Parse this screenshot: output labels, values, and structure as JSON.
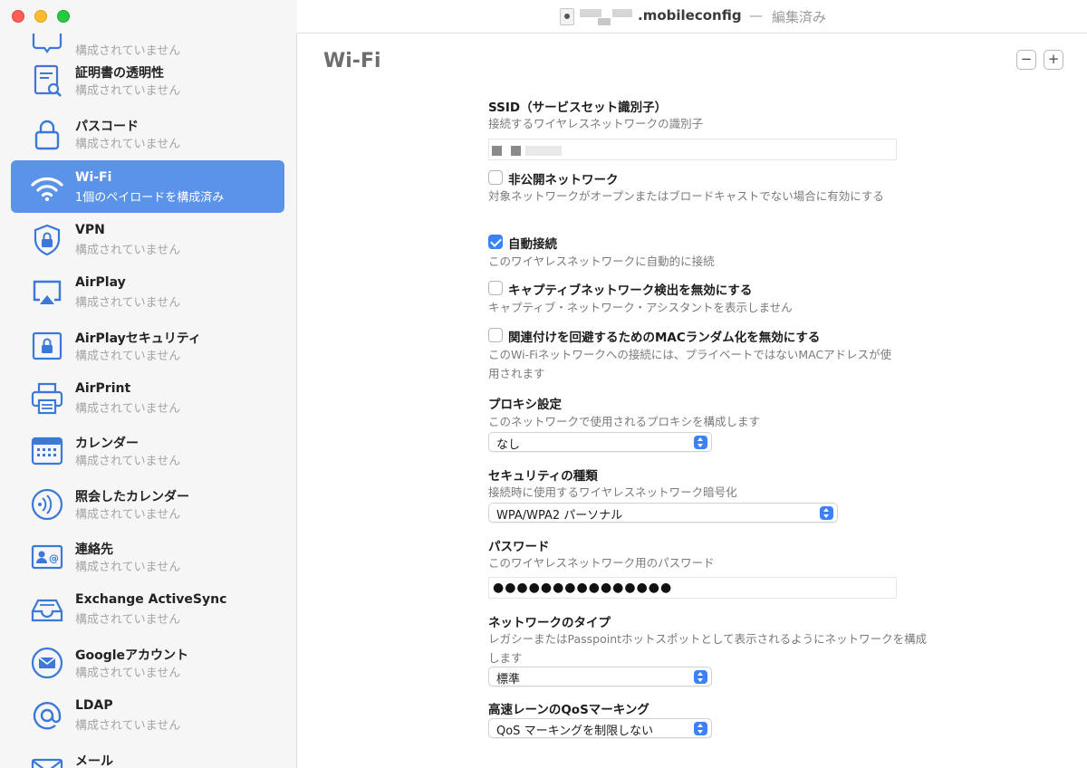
{
  "window": {
    "filename": ".mobileconfig",
    "separator": "—",
    "status": "編集済み"
  },
  "sidebar": {
    "items": [
      {
        "title": "",
        "subtitle": "構成されていません",
        "icon": "speech-bubble-icon"
      },
      {
        "title": "証明書の透明性",
        "subtitle": "構成されていません",
        "icon": "certificate-search-icon"
      },
      {
        "title": "パスコード",
        "subtitle": "構成されていません",
        "icon": "lock-icon"
      },
      {
        "title": "Wi-Fi",
        "subtitle": "1個のペイロードを構成済み",
        "icon": "wifi-icon",
        "selected": true
      },
      {
        "title": "VPN",
        "subtitle": "構成されていません",
        "icon": "shield-lock-icon"
      },
      {
        "title": "AirPlay",
        "subtitle": "構成されていません",
        "icon": "airplay-icon"
      },
      {
        "title": "AirPlayセキュリティ",
        "subtitle": "構成されていません",
        "icon": "airplay-lock-icon"
      },
      {
        "title": "AirPrint",
        "subtitle": "構成されていません",
        "icon": "printer-icon"
      },
      {
        "title": "カレンダー",
        "subtitle": "構成されていません",
        "icon": "calendar-icon"
      },
      {
        "title": "照会したカレンダー",
        "subtitle": "構成されていません",
        "icon": "subscribed-calendar-icon"
      },
      {
        "title": "連絡先",
        "subtitle": "構成されていません",
        "icon": "contacts-icon"
      },
      {
        "title": "Exchange ActiveSync",
        "subtitle": "構成されていません",
        "icon": "inbox-tray-icon"
      },
      {
        "title": "Googleアカウント",
        "subtitle": "構成されていません",
        "icon": "mail-circle-icon"
      },
      {
        "title": "LDAP",
        "subtitle": "構成されていません",
        "icon": "at-sign-icon"
      },
      {
        "title": "メール",
        "subtitle": "",
        "icon": "mail-icon"
      }
    ]
  },
  "main": {
    "section_title": "Wi-Fi",
    "minus_label": "−",
    "plus_label": "+",
    "ssid": {
      "label": "SSID（サービスセット識別子）",
      "description": "接続するワイヤレスネットワークの識別子",
      "value": ""
    },
    "hidden_network": {
      "label": "非公開ネットワーク",
      "checked": false,
      "description": "対象ネットワークがオープンまたはブロードキャストでない場合に有効にする"
    },
    "auto_join": {
      "label": "自動接続",
      "checked": true,
      "description": "このワイヤレスネットワークに自動的に接続"
    },
    "captive": {
      "label": "キャプティブネットワーク検出を無効にする",
      "checked": false,
      "description": "キャプティブ・ネットワーク・アシスタントを表示しません"
    },
    "mac_random": {
      "label": "関連付けを回避するためのMACランダム化を無効にする",
      "checked": false,
      "description": "このWi-Fiネットワークへの接続には、プライベートではないMACアドレスが使用されます"
    },
    "proxy": {
      "label": "プロキシ設定",
      "description": "このネットワークで使用されるプロキシを構成します",
      "selected": "なし"
    },
    "security": {
      "label": "セキュリティの種類",
      "description": "接続時に使用するワイヤレスネットワーク暗号化",
      "selected": "WPA/WPA2 パーソナル"
    },
    "password": {
      "label": "パスワード",
      "description": "このワイヤレスネットワーク用のパスワード",
      "value": "●●●●●●●●●●●●●●●"
    },
    "network_type": {
      "label": "ネットワークのタイプ",
      "description": "レガシーまたはPasspointホットスポットとして表示されるようにネットワークを構成します",
      "selected": "標準"
    },
    "qos": {
      "label": "高速レーンのQoSマーキング",
      "selected": "QoS マーキングを制限しない"
    }
  },
  "colors": {
    "selection": "#5b93e8",
    "accent": "#3b82f6",
    "icon_blue": "#3b78d8"
  }
}
